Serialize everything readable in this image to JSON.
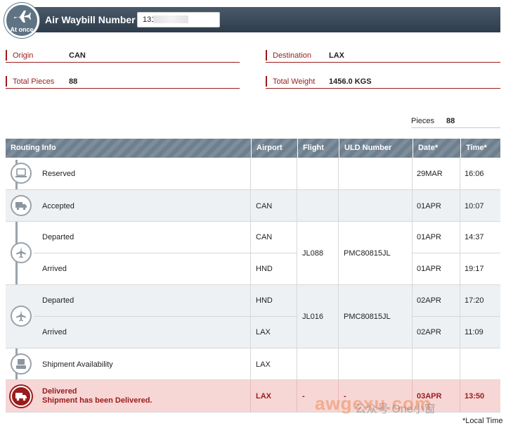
{
  "header": {
    "logo_text": "At once",
    "title": "Air Waybill Number",
    "awb_value": "131"
  },
  "info": {
    "origin_label": "Origin",
    "origin_value": "CAN",
    "destination_label": "Destination",
    "destination_value": "LAX",
    "pieces_label": "Total Pieces",
    "pieces_value": "88",
    "weight_label": "Total Weight",
    "weight_value": "1456.0 KGS"
  },
  "summary": {
    "pieces_label": "Pieces",
    "pieces_value": "88"
  },
  "table": {
    "headers": [
      "Routing Info",
      "Airport",
      "Flight",
      "ULD Number",
      "Date*",
      "Time*"
    ],
    "rows": [
      {
        "status": "Reserved",
        "airport": "",
        "flight": "",
        "uld": "",
        "date": "29MAR",
        "time": "16:06",
        "icon": "computer-icon"
      },
      {
        "status": "Accepted",
        "airport": "CAN",
        "flight": "",
        "uld": "",
        "date": "01APR",
        "time": "10:07",
        "icon": "truck-icon"
      },
      {
        "status": "Departed",
        "airport": "CAN",
        "flight": "JL088",
        "uld": "PMC80815JL",
        "date": "01APR",
        "time": "14:37",
        "icon": "airplane-icon"
      },
      {
        "status": "Arrived",
        "airport": "HND",
        "flight": "JL088",
        "uld": "PMC80815JL",
        "date": "01APR",
        "time": "19:17"
      },
      {
        "status": "Departed",
        "airport": "HND",
        "flight": "JL016",
        "uld": "PMC80815JL",
        "date": "02APR",
        "time": "17:20",
        "icon": "airplane-icon"
      },
      {
        "status": "Arrived",
        "airport": "LAX",
        "flight": "JL016",
        "uld": "PMC80815JL",
        "date": "02APR",
        "time": "11:09"
      },
      {
        "status": "Shipment Availability",
        "airport": "LAX",
        "flight": "",
        "uld": "",
        "date": "",
        "time": "",
        "icon": "package-icon"
      },
      {
        "status": "Delivered",
        "status_detail": "Shipment has been Delivered.",
        "airport": "LAX",
        "flight": "-",
        "uld": "-",
        "date": "03APR",
        "time": "13:50",
        "icon": "delivery-truck-icon"
      }
    ]
  },
  "footer": {
    "local_time_note": "*Local Time"
  },
  "watermark": {
    "text": "awgexu.com",
    "text2": "公众号 One小窗"
  },
  "colors": {
    "accent_red": "#9b1b1b",
    "header_dark": "#2e3c4b",
    "table_header": "#6e7f8e",
    "delivered_bg": "#f7d6d6"
  }
}
